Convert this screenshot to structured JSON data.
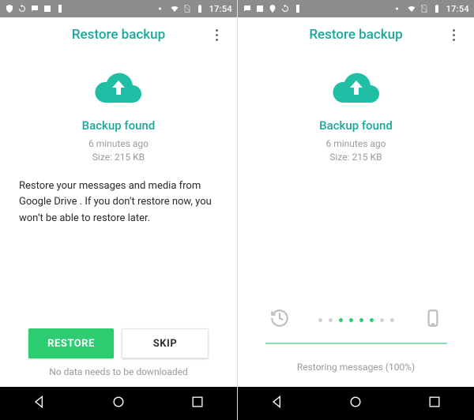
{
  "status": {
    "time": "17:54"
  },
  "header": {
    "title": "Restore backup"
  },
  "backup": {
    "title": "Backup found",
    "time": "6 minutes ago",
    "size": "Size: 215 KB"
  },
  "left": {
    "desc": "Restore your messages and media from Google Drive . If you don’t restore now, you won’t be able to restore later.",
    "restore": "RESTORE",
    "skip": "SKIP",
    "note": "No data needs to be downloaded"
  },
  "right": {
    "progress": "Restoring messages (100%)"
  }
}
